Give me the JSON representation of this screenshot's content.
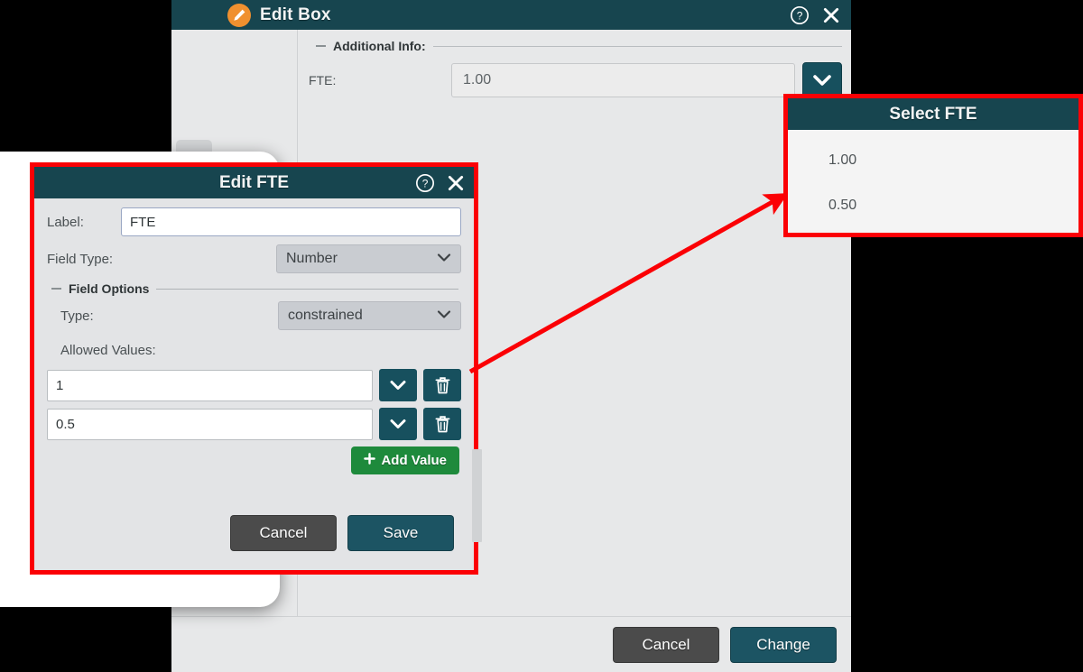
{
  "edit_box": {
    "title": "Edit Box",
    "title_icon": "pencil-icon",
    "help_icon": "question-circle-icon",
    "close_icon": "close-x-icon",
    "section_legend": "Additional Info:",
    "fields": [
      {
        "label": "FTE:",
        "value": "1.00",
        "dropdown_icon": "chevron-down-icon"
      }
    ],
    "footer": {
      "cancel_label": "Cancel",
      "primary_label": "Change"
    }
  },
  "edit_fte": {
    "title": "Edit FTE",
    "help_icon": "question-circle-icon",
    "close_icon": "close-x-icon",
    "label_field": {
      "label": "Label:",
      "value": "FTE"
    },
    "field_type": {
      "label": "Field Type:",
      "value": "Number",
      "caret_icon": "chevron-down-icon"
    },
    "field_options_legend": "Field Options",
    "type_field": {
      "label": "Type:",
      "value": "constrained",
      "caret_icon": "chevron-down-icon"
    },
    "allowed_values_label": "Allowed Values:",
    "allowed_values": [
      {
        "value": "1",
        "dropdown_icon": "chevron-down-icon",
        "delete_icon": "trash-icon"
      },
      {
        "value": "0.5",
        "dropdown_icon": "chevron-down-icon",
        "delete_icon": "trash-icon"
      }
    ],
    "add_value_label": "Add Value",
    "add_value_icon": "plus-icon",
    "footer": {
      "cancel_label": "Cancel",
      "primary_label": "Save"
    }
  },
  "select_fte": {
    "title": "Select FTE",
    "options": [
      {
        "label": "1.00"
      },
      {
        "label": "0.50"
      }
    ]
  },
  "annotation": {
    "arrow_color": "#fb0005",
    "highlight_color": "#fb0005"
  },
  "colors": {
    "titlebar_teal": "#17454f",
    "accent_teal": "#17505e",
    "green": "#1e8a3c",
    "grey_button": "#4b4b4b",
    "panel_bg": "#e7e8e9"
  }
}
